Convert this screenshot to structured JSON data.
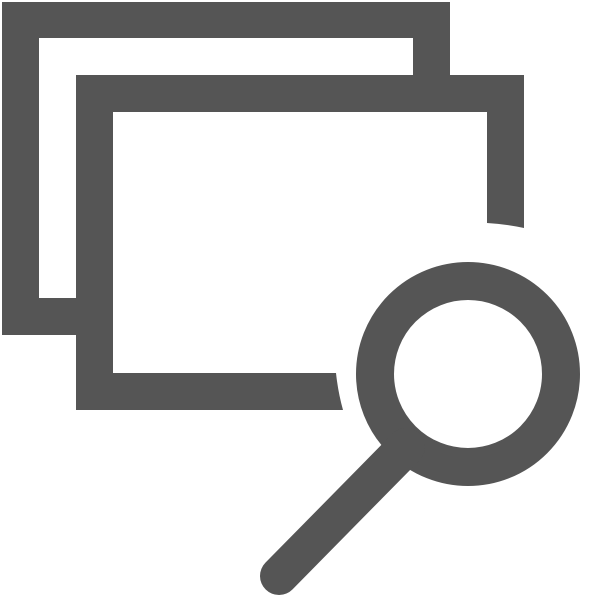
{
  "icon": {
    "name": "search-windows-icon",
    "parts": [
      "back-window",
      "front-window",
      "magnifying-glass"
    ]
  },
  "colors": {
    "stroke": "#555555",
    "background": "#ffffff"
  }
}
